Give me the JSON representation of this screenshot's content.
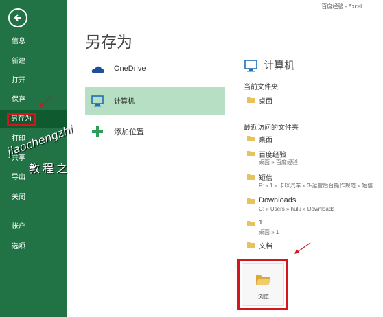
{
  "window_title": "百度经验 - Excel",
  "page_title": "另存为",
  "nav": {
    "items": [
      {
        "label": "信息"
      },
      {
        "label": "新建"
      },
      {
        "label": "打开"
      },
      {
        "label": "保存"
      },
      {
        "label": "另存为"
      },
      {
        "label": "打印"
      },
      {
        "label": "共享"
      },
      {
        "label": "导出"
      },
      {
        "label": "关闭"
      },
      {
        "label": "帐户"
      },
      {
        "label": "选项"
      }
    ]
  },
  "watermark": {
    "line1": "jiaochengzhi",
    "line2": "教程之"
  },
  "locations": [
    {
      "label": "OneDrive",
      "icon": "cloud-icon"
    },
    {
      "label": "计算机",
      "icon": "computer-icon",
      "selected": true
    },
    {
      "label": "添加位置",
      "icon": "plus-icon"
    }
  ],
  "right": {
    "title": "计算机",
    "current_folder_label": "当前文件夹",
    "current_folder": {
      "name": "桌面"
    },
    "recent_label": "最近访问的文件夹",
    "recent": [
      {
        "name": "桌面",
        "path": ""
      },
      {
        "name": "百度经验",
        "path": "桌面 » 百度经验"
      },
      {
        "name": "短信",
        "path": "F: » 1 » 卡咪汽车 » 3-运营后台操作规范 » 短信"
      },
      {
        "name": "Downloads",
        "path": "C: » Users » hulu » Downloads"
      },
      {
        "name": "1",
        "path": "桌面 » 1"
      },
      {
        "name": "文档",
        "path": ""
      }
    ],
    "browse_label": "浏览"
  },
  "colors": {
    "nav_green": "#217346",
    "nav_active": "#0f5a2e",
    "selected_location": "#b7dfc3",
    "highlight_red": "#d6141c",
    "folder_yellow": "#e8c25b"
  }
}
